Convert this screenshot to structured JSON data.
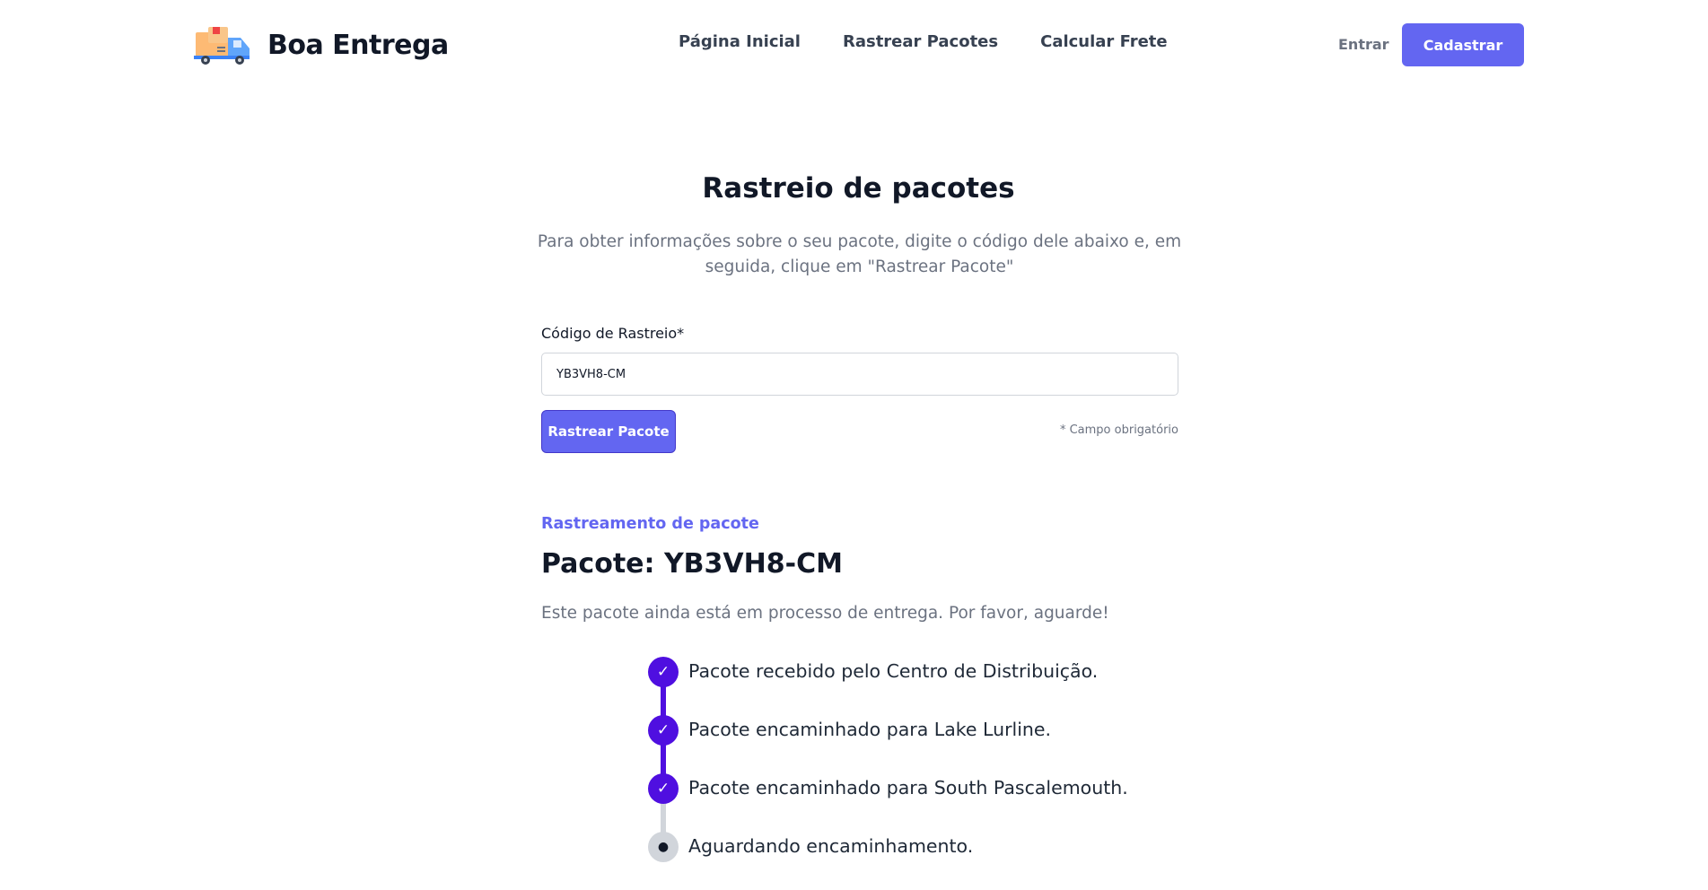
{
  "header": {
    "brand": "Boa Entrega",
    "nav": [
      "Página Inicial",
      "Rastrear Pacotes",
      "Calcular Frete"
    ],
    "login_label": "Entrar",
    "signup_label": "Cadastrar"
  },
  "search": {
    "title": "Rastreio de pacotes",
    "description": "Para obter informações sobre o seu pacote, digite o código dele abaixo e, em seguida, clique em \"Rastrear Pacote\"",
    "field_label": "Código de Rastreio*",
    "field_value": "YB3VH8-CM",
    "button_label": "Rastrear Pacote",
    "required_note": "* Campo obrigatório"
  },
  "result": {
    "eyebrow": "Rastreamento de pacote",
    "title": "Pacote: YB3VH8-CM",
    "status": "Este pacote ainda está em processo de entrega. Por favor, aguarde!",
    "steps": [
      {
        "label": "Pacote recebido pelo Centro de Distribuição.",
        "state": "done",
        "icon": "check-icon",
        "glyph": "✓"
      },
      {
        "label": "Pacote encaminhado para Lake Lurline.",
        "state": "done",
        "icon": "check-icon",
        "glyph": "✓"
      },
      {
        "label": "Pacote encaminhado para South Pascalemouth.",
        "state": "done",
        "icon": "check-icon",
        "glyph": "✓"
      },
      {
        "label": "Aguardando encaminhamento.",
        "state": "pending",
        "icon": "pending-dot-icon",
        "glyph": "●"
      }
    ]
  },
  "colors": {
    "accent": "#6366f1",
    "timeline_done": "#4f0fe0",
    "timeline_pending": "#d1d5db"
  }
}
